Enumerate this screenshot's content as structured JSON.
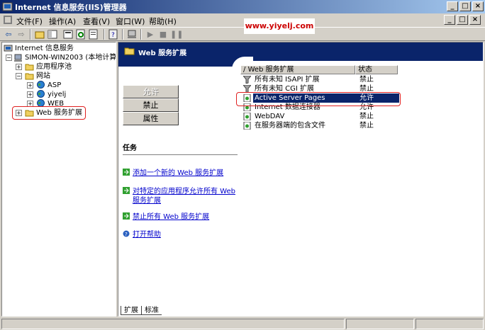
{
  "window": {
    "title": "Internet 信息服务(IIS)管理器",
    "controls": {
      "minimize": "_",
      "maximize": "□",
      "close": "×"
    }
  },
  "menu": {
    "items": [
      "文件(F)",
      "操作(A)",
      "查看(V)",
      "窗口(W)",
      "帮助(H)"
    ]
  },
  "watermark": "www.yiyelj.com",
  "tree": {
    "root": "Internet 信息服务",
    "server": "SIMON-WIN2003 (本地计算机)",
    "app_pools": "应用程序池",
    "websites": "网站",
    "sites": [
      "ASP",
      "yiyelj",
      "WEB"
    ],
    "web_ext": "Web 服务扩展"
  },
  "pane": {
    "header": "Web 服务扩展",
    "buttons": {
      "allow": "允许",
      "prohibit": "禁止",
      "properties": "属性"
    },
    "tasks_title": "任务",
    "tasks": [
      {
        "label": "添加一个新的 Web 服务扩展"
      },
      {
        "label": "对特定的应用程序允许所有 Web 服务扩展"
      },
      {
        "label": "禁止所有 Web 服务扩展"
      },
      {
        "label": "打开帮助"
      }
    ]
  },
  "list": {
    "columns": [
      "Web 服务扩展",
      "状态"
    ],
    "rows": [
      {
        "name": "所有未知 ISAPI 扩展",
        "status": "禁止"
      },
      {
        "name": "所有未知 CGI 扩展",
        "status": "禁止"
      },
      {
        "name": "Active Server Pages",
        "status": "允许",
        "selected": true
      },
      {
        "name": "Internet 数据连接器",
        "status": "允许"
      },
      {
        "name": "WebDAV",
        "status": "禁止"
      },
      {
        "name": "在服务器端的包含文件",
        "status": "禁止"
      }
    ]
  },
  "tabs": [
    "扩展",
    "标准"
  ],
  "colors": {
    "accent": "#0a246a",
    "highlight": "#e02020",
    "link": "#0000cc"
  }
}
